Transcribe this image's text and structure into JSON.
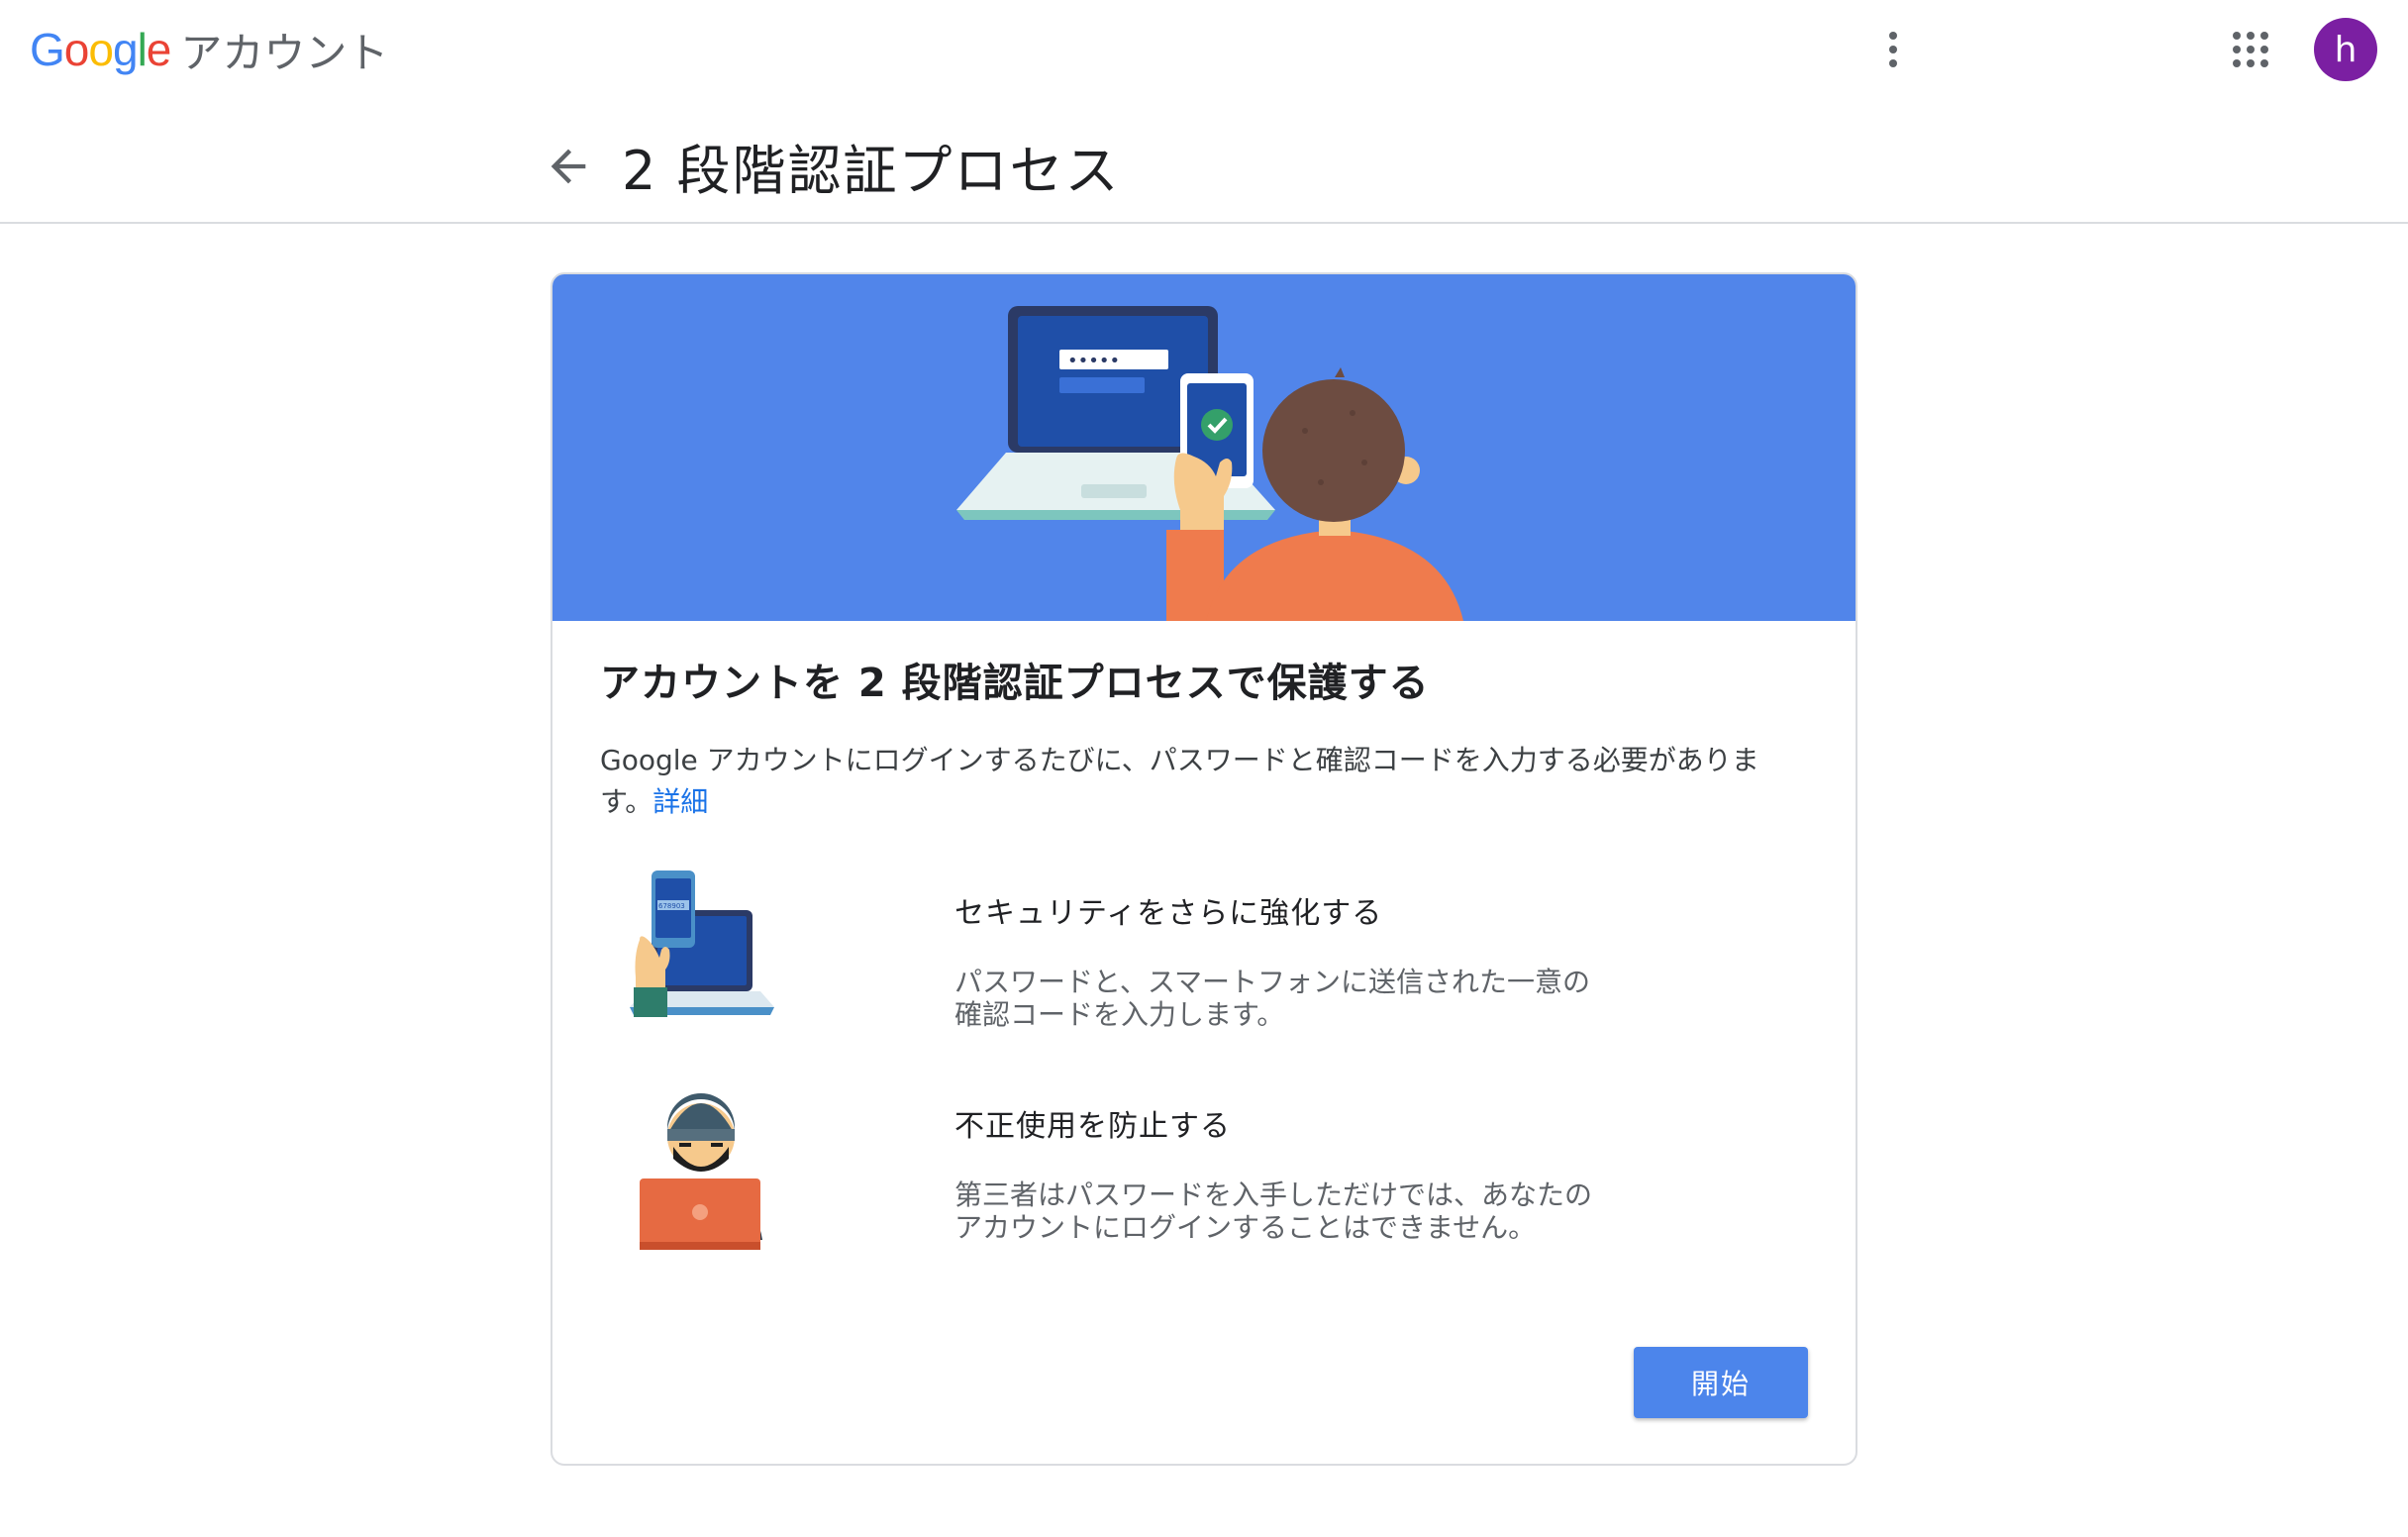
{
  "app": {
    "logo_letters": [
      {
        "ch": "G",
        "color": "#4285F4"
      },
      {
        "ch": "o",
        "color": "#EA4335"
      },
      {
        "ch": "o",
        "color": "#FBBC05"
      },
      {
        "ch": "g",
        "color": "#4285F4"
      },
      {
        "ch": "l",
        "color": "#34A853"
      },
      {
        "ch": "e",
        "color": "#EA4335"
      }
    ],
    "product_name": "アカウント",
    "avatar_initial": "h",
    "avatar_color": "#7B1FA2"
  },
  "header": {
    "title": "2 段階認証プロセス"
  },
  "card": {
    "hero_color": "#5185EA",
    "hero_password_mask": "•••••",
    "title": "アカウントを 2 段階認証プロセスで保護する",
    "description": "Google アカウントにログインするたびに、パスワードと確認コードを入力する必要があります。",
    "learn_more": "詳細",
    "features": [
      {
        "icon": "phone-laptop-illustration",
        "title": "セキュリティをさらに強化する",
        "description_lines": [
          "パスワードと、スマートフォンに送信された一意の",
          "確認コードを入力します。"
        ],
        "code_text": "678903"
      },
      {
        "icon": "thief-laptop-illustration",
        "title": "不正使用を防止する",
        "description_lines": [
          "第三者はパスワードを入手しただけでは、あなたの",
          "アカウントにログインすることはできません。"
        ]
      }
    ],
    "start_button": "開始",
    "accent_color": "#4C85EB"
  }
}
